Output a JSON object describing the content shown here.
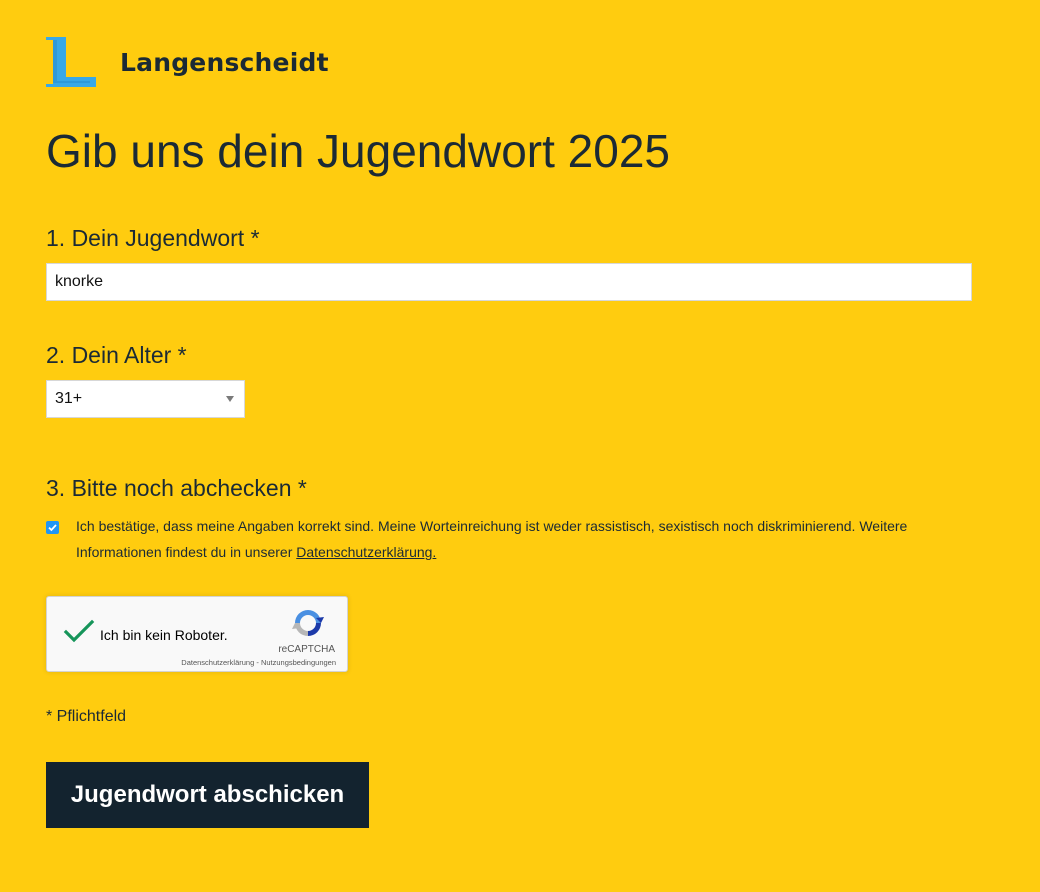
{
  "header": {
    "logo_letter": "L",
    "brand_name": "Langenscheidt"
  },
  "page": {
    "title": "Gib uns dein Jugendwort 2025"
  },
  "form": {
    "q1_label": "1. Dein Jugendwort *",
    "word_value": "knorke",
    "q2_label": "2. Dein Alter *",
    "age_selected": "31+",
    "q3_label": "3. Bitte noch abchecken *",
    "consent_text": "Ich bestätige, dass meine Angaben korrekt sind. Meine Worteinreichung ist weder rassistisch, sexistisch noch diskriminierend. Weitere Informationen findest du in unserer ",
    "consent_link": "Datenschutzerklärung.",
    "consent_checked": true,
    "required_note": "* Pflichtfeld",
    "submit_label": "Jugendwort abschicken"
  },
  "recaptcha": {
    "label": "Ich bin kein Roboter.",
    "brand": "reCAPTCHA",
    "privacy_link": "Datenschutzerklärung",
    "separator": " - ",
    "terms_link": "Nutzungsbedingungen"
  },
  "colors": {
    "background": "#ffcc0f",
    "text": "#1b2a35",
    "button": "#13232f",
    "logo_blue": "#38a8e6",
    "checkbox": "#2196f3",
    "recaptcha_check": "#16955a"
  },
  "icons": {
    "logo": "langenscheidt-l-logo",
    "select_caret": "chevron-down-icon",
    "checkbox": "checkmark-icon",
    "recaptcha_check": "green-check-icon",
    "recaptcha_logo": "recaptcha-icon"
  }
}
